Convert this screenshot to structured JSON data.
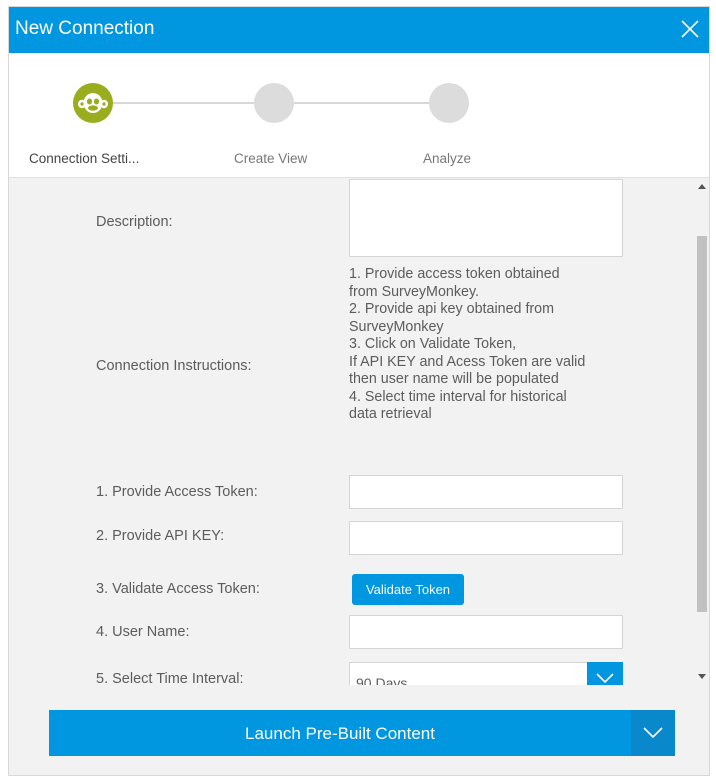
{
  "dialog": {
    "title": "New Connection",
    "close_icon": "close-icon"
  },
  "steps": [
    {
      "label": "Connection Setti...",
      "active": true,
      "icon": "surveymonkey-logo-icon"
    },
    {
      "label": "Create View",
      "active": false
    },
    {
      "label": "Analyze",
      "active": false
    }
  ],
  "form": {
    "description_label": "Description:",
    "description_value": "",
    "instructions_label": "Connection Instructions:",
    "instructions_lines": [
      "1. Provide access token obtained",
      "from SurveyMonkey.",
      "2. Provide api key obtained from",
      "SurveyMonkey",
      "3. Click on Validate Token,",
      "If API KEY and Acess Token are valid",
      "then user name will be populated",
      "4. Select time interval for historical",
      "data retrieval"
    ],
    "access_token_label": "1. Provide Access Token:",
    "access_token_value": "",
    "api_key_label": "2. Provide API KEY:",
    "api_key_value": "",
    "validate_label": "3. Validate Access Token:",
    "validate_button": "Validate Token",
    "user_name_label": "4. User Name:",
    "user_name_value": "",
    "time_interval_label": "5. Select Time Interval:",
    "time_interval_value": "90 Days"
  },
  "footer": {
    "launch_button": "Launch Pre-Built Content"
  },
  "colors": {
    "accent": "#0096e0",
    "step_active": "#99ad1e",
    "step_inactive": "#dcdcdc"
  }
}
